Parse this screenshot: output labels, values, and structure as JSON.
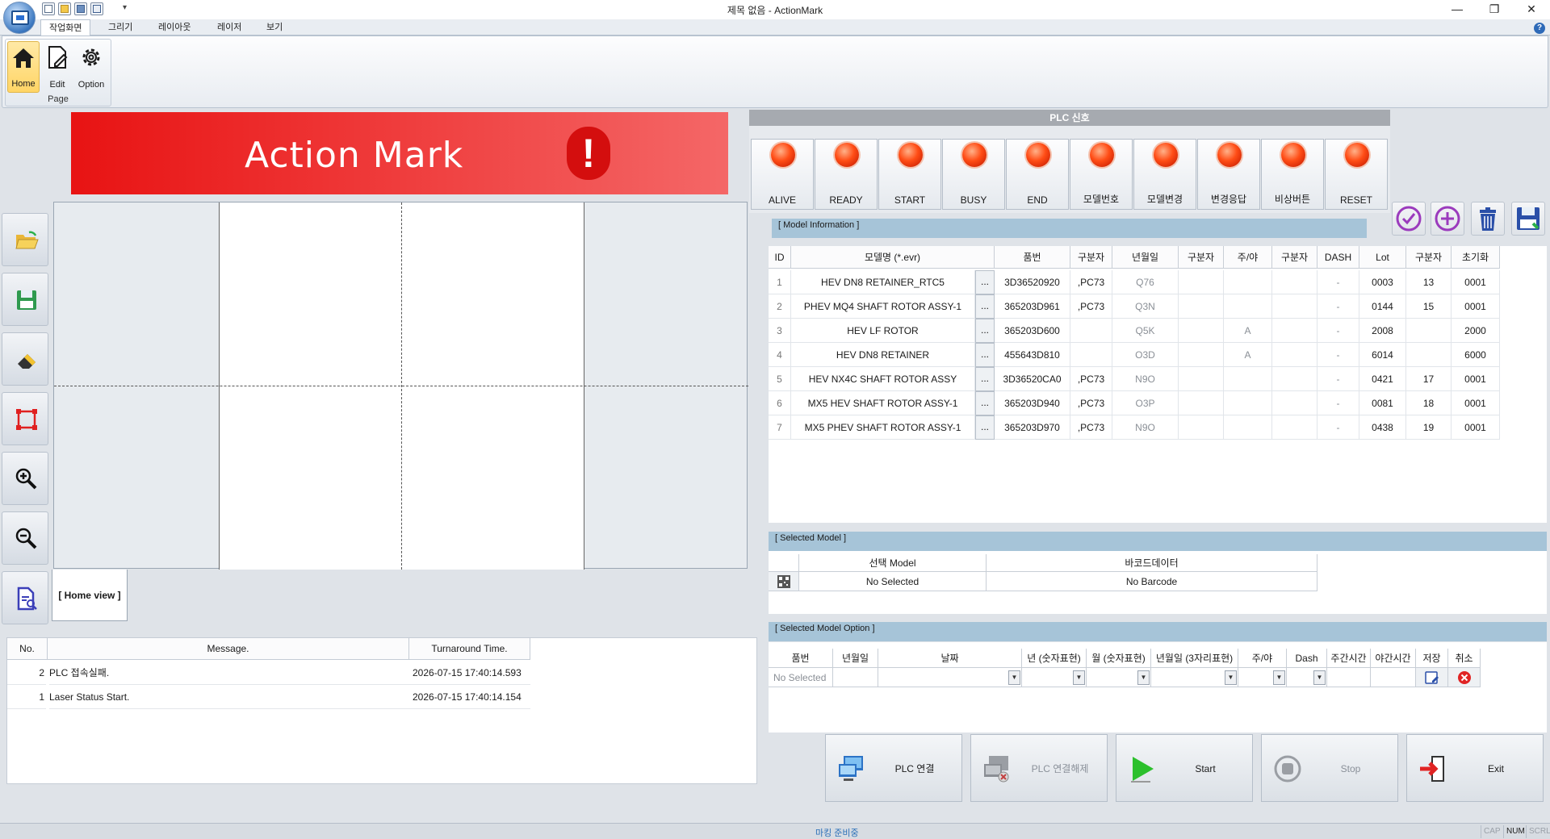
{
  "window": {
    "title": "제목 없음 - ActionMark",
    "min": "—",
    "max": "❐",
    "close": "✕"
  },
  "ribbon": {
    "tabs": [
      "작업화면",
      "그리기",
      "레이아웃",
      "레이저",
      "보기"
    ],
    "group_label": "Page",
    "buttons": [
      "Home",
      "Edit",
      "Option"
    ],
    "help": "?"
  },
  "banner": {
    "title": "Action Mark",
    "alert": "!"
  },
  "canvas": {
    "view_tab": "[  Home view  ]"
  },
  "log": {
    "headers": [
      "No.",
      "Message.",
      "Turnaround Time."
    ],
    "rows": [
      {
        "no": "2",
        "msg": "PLC 접속실패.",
        "time": "2026-07-15 17:40:14.593"
      },
      {
        "no": "1",
        "msg": "Laser Status Start.",
        "time": "2026-07-15 17:40:14.154"
      }
    ]
  },
  "plc": {
    "header": "PLC 신호",
    "signals": [
      "ALIVE",
      "READY",
      "START",
      "BUSY",
      "END",
      "모델번호",
      "모델변경",
      "변경응답",
      "비상버튼",
      "RESET"
    ],
    "led_color": "#ff4d16"
  },
  "model_info": {
    "title": "[ Model Information ]",
    "headers": [
      "ID",
      "모델명 (*.evr)",
      "품번",
      "구분자",
      "년월일",
      "구분자",
      "주/야",
      "구분자",
      "DASH",
      "Lot",
      "구분자",
      "초기화"
    ],
    "dots": "...",
    "rows": [
      {
        "id": "1",
        "name": "HEV DN8 RETAINER_RTC5",
        "part": "3D36520920",
        "sep1": ",PC73",
        "date": "Q76",
        "sep2": "",
        "dn": "",
        "sep3": "",
        "dash": "-",
        "lot": "0003",
        "sep4": "13",
        "init": "0001"
      },
      {
        "id": "2",
        "name": "PHEV MQ4 SHAFT ROTOR ASSY-1",
        "part": "365203D961",
        "sep1": ",PC73",
        "date": "Q3N",
        "sep2": "",
        "dn": "",
        "sep3": "",
        "dash": "-",
        "lot": "0144",
        "sep4": "15",
        "init": "0001"
      },
      {
        "id": "3",
        "name": "HEV LF ROTOR",
        "part": "365203D600",
        "sep1": "",
        "date": "Q5K",
        "sep2": "",
        "dn": "A",
        "sep3": "",
        "dash": "-",
        "lot": "2008",
        "sep4": "",
        "init": "2000"
      },
      {
        "id": "4",
        "name": "HEV DN8 RETAINER",
        "part": "455643D810",
        "sep1": "",
        "date": "O3D",
        "sep2": "",
        "dn": "A",
        "sep3": "",
        "dash": "-",
        "lot": "6014",
        "sep4": "",
        "init": "6000"
      },
      {
        "id": "5",
        "name": "HEV NX4C SHAFT ROTOR ASSY",
        "part": "3D36520CA0",
        "sep1": ",PC73",
        "date": "N9O",
        "sep2": "",
        "dn": "",
        "sep3": "",
        "dash": "-",
        "lot": "0421",
        "sep4": "17",
        "init": "0001"
      },
      {
        "id": "6",
        "name": "MX5 HEV SHAFT ROTOR ASSY-1",
        "part": "365203D940",
        "sep1": ",PC73",
        "date": "O3P",
        "sep2": "",
        "dn": "",
        "sep3": "",
        "dash": "-",
        "lot": "0081",
        "sep4": "18",
        "init": "0001"
      },
      {
        "id": "7",
        "name": "MX5 PHEV SHAFT ROTOR ASSY-1",
        "part": "365203D970",
        "sep1": ",PC73",
        "date": "N9O",
        "sep2": "",
        "dn": "",
        "sep3": "",
        "dash": "-",
        "lot": "0438",
        "sep4": "19",
        "init": "0001"
      }
    ]
  },
  "selected_model": {
    "title": "[ Selected Model ]",
    "headers": [
      "선택 Model",
      "바코드데이터"
    ],
    "model": "No Selected",
    "barcode": "No Barcode"
  },
  "model_option": {
    "title": "[ Selected Model Option ]",
    "headers": [
      "품번",
      "년월일",
      "날짜",
      "년 (숫자표현)",
      "월 (숫자표현)",
      "년월일 (3자리표현)",
      "주/야",
      "Dash",
      "주간시간",
      "야간시간",
      "저장",
      "취소"
    ],
    "part_value": "No Selected"
  },
  "actions": {
    "plc_connect": "PLC 연결",
    "plc_disconnect": "PLC 연결해제",
    "start": "Start",
    "stop": "Stop",
    "exit": "Exit"
  },
  "status": {
    "text": "마킹 준비중",
    "indicators": [
      "CAP",
      "NUM",
      "SCRL"
    ]
  }
}
